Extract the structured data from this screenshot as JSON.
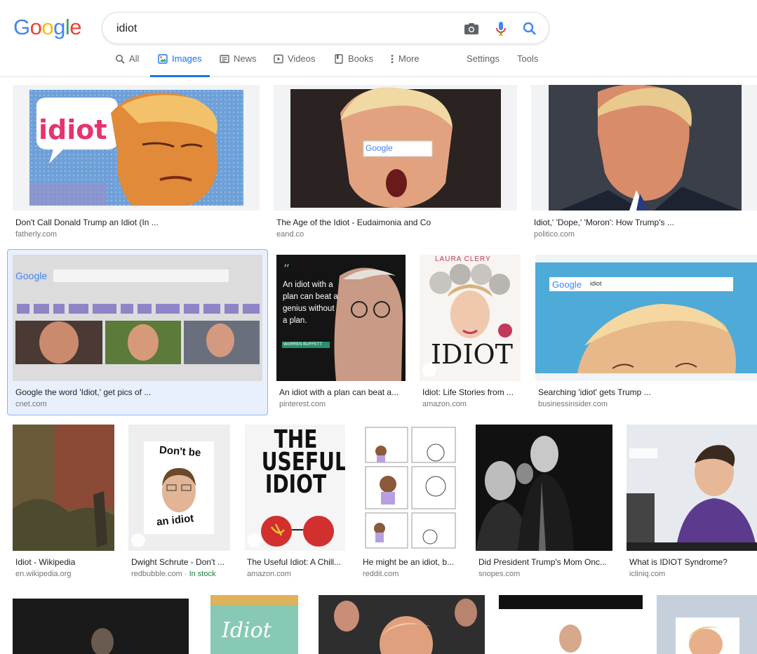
{
  "logo": {
    "letters": [
      "G",
      "o",
      "o",
      "g",
      "l",
      "e"
    ],
    "colors": [
      "#4285f4",
      "#ea4335",
      "#fbbc05",
      "#4285f4",
      "#34a853",
      "#ea4335"
    ]
  },
  "search": {
    "value": "idiot"
  },
  "tabs": [
    {
      "label": "All",
      "icon": "search-icon"
    },
    {
      "label": "Images",
      "icon": "images-icon"
    },
    {
      "label": "News",
      "icon": "news-icon"
    },
    {
      "label": "Videos",
      "icon": "videos-icon"
    },
    {
      "label": "Books",
      "icon": "books-icon"
    },
    {
      "label": "More",
      "icon": "more-icon"
    }
  ],
  "settings_label": "Settings",
  "tools_label": "Tools",
  "results": [
    {
      "title": "Don't Call Donald Trump an Idiot (In ...",
      "source": "fatherly.com",
      "overlay": "idiot"
    },
    {
      "title": "The Age of the Idiot - Eudaimonia and Co",
      "source": "eand.co",
      "overlay": "Google"
    },
    {
      "title": "Idiot,' 'Dope,' 'Moron': How Trump's ...",
      "source": "politico.com"
    },
    {
      "title": "Google the word 'Idiot,' get pics of ...",
      "source": "cnet.com",
      "overlay": "Google"
    },
    {
      "title": "An idiot with a plan can beat a...",
      "source": "pinterest.com",
      "overlay": "An idiot with a plan can beat a genius without a plan.",
      "overlay2": "WARREN BUFFETT"
    },
    {
      "title": "Idiot: Life Stories from ...",
      "source": "amazon.com",
      "overlay": "IDIOT",
      "overlay2": "LAURA CLERY"
    },
    {
      "title": "Searching 'idiot' gets Trump ...",
      "source": "businessinsider.com",
      "overlay": "Google",
      "overlay2": "idiot"
    },
    {
      "title": "Idiot - Wikipedia",
      "source": "en.wikipedia.org"
    },
    {
      "title": "Dwight Schrute - Don't ...",
      "source": "redbubble.com",
      "stock": "In stock",
      "overlay": "Don't be",
      "overlay2": "an idiot"
    },
    {
      "title": "The Useful Idiot: A Chill...",
      "source": "amazon.com",
      "overlay": "THE USEFUL IDIOT"
    },
    {
      "title": "He might be an idiot, b...",
      "source": "reddit.com"
    },
    {
      "title": "Did President Trump's Mom Onc...",
      "source": "snopes.com"
    },
    {
      "title": "What is IDIOT Syndrome?",
      "source": "icliniq.com"
    }
  ],
  "colors": {
    "accent": "#1a73e8",
    "selected_bg": "#e8f0fe"
  }
}
